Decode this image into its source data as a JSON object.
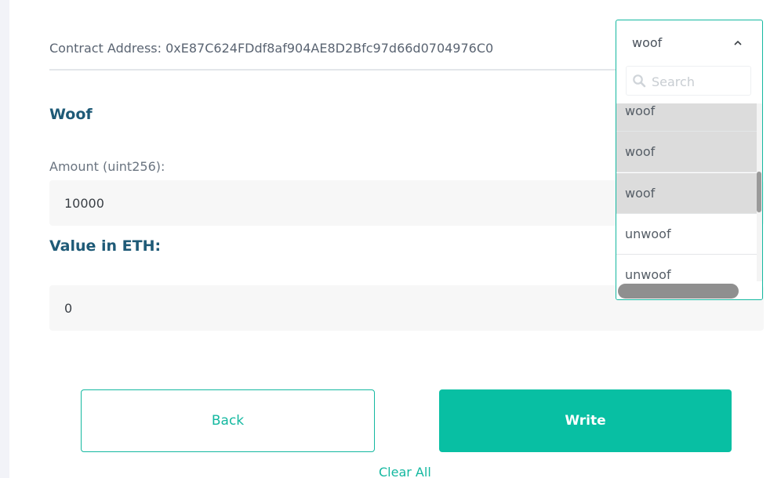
{
  "contract": {
    "address_text": "Contract Address: 0xE87C624FDdf8af904AE8D2Bfc97d66d0704976C0"
  },
  "function": {
    "title": "Woof"
  },
  "inputs": {
    "amount_label": "Amount (uint256):",
    "amount_value": "10000",
    "value_label": "Value in ETH:",
    "value_value": "0"
  },
  "actions": {
    "back_label": "Back",
    "write_label": "Write",
    "clear_all_label": "Clear All"
  },
  "dropdown": {
    "selected": "woof",
    "search_placeholder": "Search",
    "options": [
      {
        "label": "woof",
        "highlighted": true
      },
      {
        "label": "woof",
        "highlighted": true
      },
      {
        "label": "woof",
        "highlighted": true
      },
      {
        "label": "unwoof",
        "highlighted": false
      },
      {
        "label": "unwoof",
        "highlighted": false
      }
    ],
    "icons": {
      "chevron": "chevron-up-icon",
      "search": "search-icon"
    }
  },
  "colors": {
    "accent": "#08bfa3",
    "heading": "#1e5a77",
    "highlight_row": "#dcdcdc"
  }
}
